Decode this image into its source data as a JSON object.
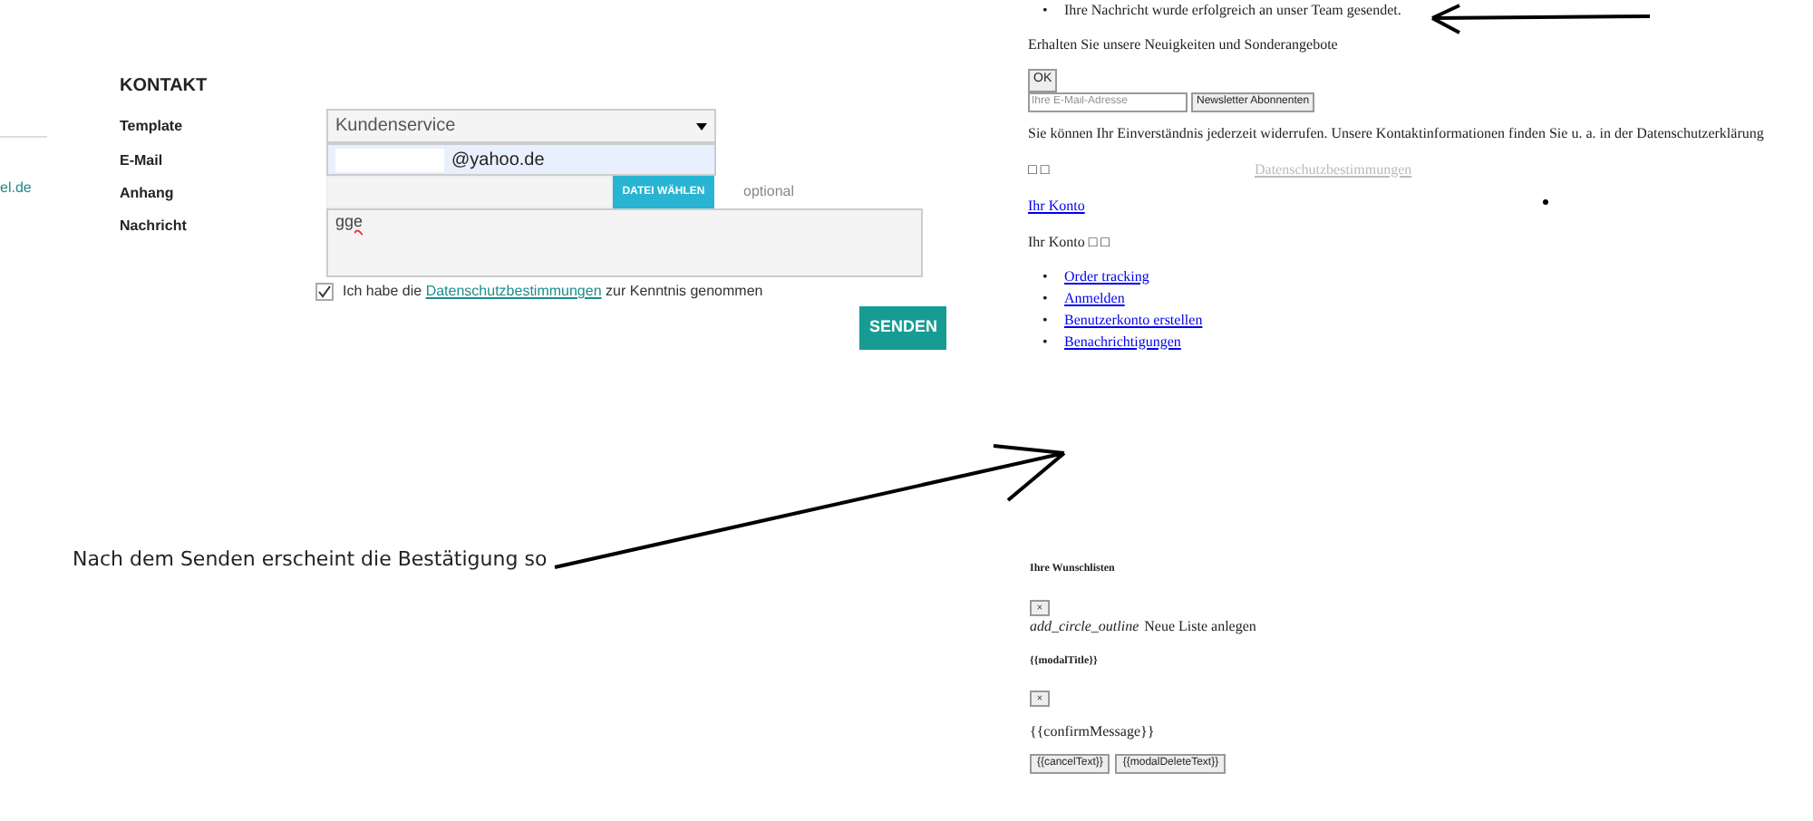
{
  "side_fragment": {
    "link": "el.de"
  },
  "contact_form": {
    "title": "KONTAKT",
    "fields": [
      {
        "kind": "select",
        "label": "Template",
        "value": "Kundenservice"
      },
      {
        "kind": "email",
        "label": "E-Mail",
        "value": "@yahoo.de"
      },
      {
        "kind": "file",
        "label": "Anhang",
        "button": "DATEI WÄHLEN",
        "hint": "optional"
      },
      {
        "kind": "textarea",
        "label": "Nachricht",
        "value": "gge"
      }
    ],
    "consent": {
      "checked": true,
      "before": "Ich habe die",
      "link": "Datenschutzbestimmungen",
      "after": "zur Kenntnis genommen"
    },
    "submit": "SENDEN"
  },
  "annotation": {
    "text": "Nach dem Senden erscheint die Bestätigung so"
  },
  "result_page": {
    "bullet": "•",
    "messages": [
      "Ihre Nachricht wurde erfolgreich an unser Team gesendet."
    ],
    "newsletter_heading": "Erhalten Sie unsere Neuigkeiten und Sonderangebote",
    "ok_button": "OK",
    "email_placeholder": "Ihre E-Mail-Adresse",
    "subscribe_button": "Newsletter Abonnenten",
    "consent_text": "Sie können Ihr Einverständnis jederzeit widerrufen. Unsere Kontaktinformationen finden Sie u. a. in der Datenschutzerklärung",
    "glyphs": "□ □",
    "privacy_link": "Datenschutzbestimmungen",
    "account_link": "Ihr Konto",
    "account_label": "Ihr Konto □ □",
    "account_links": [
      "Order tracking",
      "Anmelden",
      "Benutzerkonto erstellen",
      "Benachrichtigungen"
    ]
  },
  "wishlist_page": {
    "title": "Ihre Wunschlisten",
    "close_1": "×",
    "icon_text": "add_circle_outline",
    "new_list": "Neue Liste anlegen",
    "modal_title": "{{modalTitle}}",
    "close_2": "×",
    "confirm_message": "{{confirmMessage}}",
    "buttons": [
      "{{cancelText}}",
      "{{modalDeleteText}}"
    ]
  }
}
